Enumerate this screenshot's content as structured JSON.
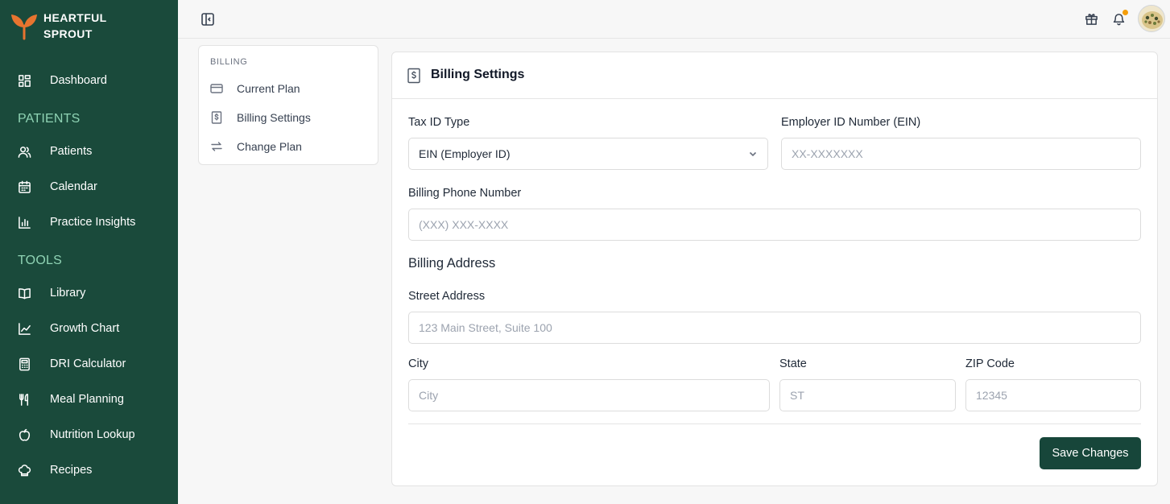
{
  "brand": {
    "line1": "HEARTFUL",
    "line2": "SPROUT"
  },
  "sidebar": {
    "dashboard": "Dashboard",
    "patients_section": "PATIENTS",
    "patients_items": [
      "Patients",
      "Calendar",
      "Practice Insights"
    ],
    "tools_section": "TOOLS",
    "tools_items": [
      "Library",
      "Growth Chart",
      "DRI Calculator",
      "Meal Planning",
      "Nutrition Lookup",
      "Recipes"
    ]
  },
  "billing_menu": {
    "heading": "BILLING",
    "items": [
      "Current Plan",
      "Billing Settings",
      "Change Plan"
    ]
  },
  "card": {
    "title": "Billing Settings",
    "tax_id_type_label": "Tax ID Type",
    "tax_id_type_value": "EIN (Employer ID)",
    "ein_label": "Employer ID Number (EIN)",
    "ein_placeholder": "XX-XXXXXXX",
    "phone_label": "Billing Phone Number",
    "phone_placeholder": "(XXX) XXX-XXXX",
    "address_heading": "Billing Address",
    "street_label": "Street Address",
    "street_placeholder": "123 Main Street, Suite 100",
    "city_label": "City",
    "city_placeholder": "City",
    "state_label": "State",
    "state_placeholder": "ST",
    "zip_label": "ZIP Code",
    "zip_placeholder": "12345",
    "save_label": "Save Changes"
  },
  "colors": {
    "sidebar_bg": "#1a4a3b",
    "section_label": "#8fd3b4",
    "primary_button": "#17463a",
    "notification_dot": "#f59e0b",
    "logo": "#e8742f"
  }
}
